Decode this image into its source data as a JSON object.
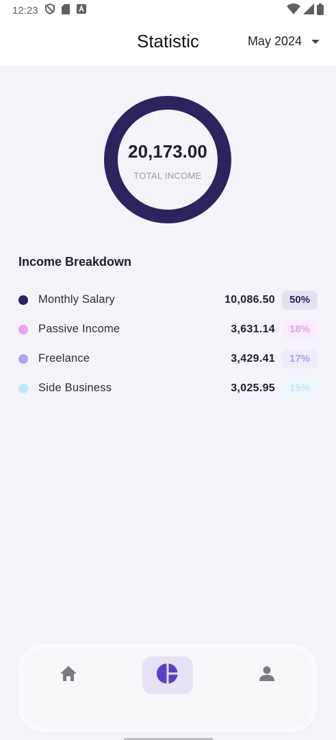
{
  "status_bar": {
    "time": "12:23"
  },
  "header": {
    "title": "Statistic",
    "month": "May 2024"
  },
  "summary": {
    "total_value": "20,173.00",
    "total_label": "TOTAL INCOME"
  },
  "breakdown": {
    "title": "Income Breakdown",
    "items": [
      {
        "label": "Monthly Salary",
        "amount": "10,086.50",
        "percent": "50%",
        "color": "#2b245f",
        "pct_bg": "#e4e1ee",
        "pct_color": "#2b245f"
      },
      {
        "label": "Passive Income",
        "amount": "3,631.14",
        "percent": "18%",
        "color": "#e9a3f0",
        "pct_bg": "#f8ecfa",
        "pct_color": "#e6a0ee"
      },
      {
        "label": "Freelance",
        "amount": "3,429.41",
        "percent": "17%",
        "color": "#b3a3ee",
        "pct_bg": "#efebfb",
        "pct_color": "#ad9ee9"
      },
      {
        "label": "Side Business",
        "amount": "3,025.95",
        "percent": "15%",
        "color": "#bfe6f5",
        "pct_bg": "#eef7fb",
        "pct_color": "#c4e8f5"
      }
    ]
  },
  "donut": {
    "ring_color": "#2b245f"
  },
  "nav": {
    "items": [
      {
        "icon": "home-icon",
        "active": false
      },
      {
        "icon": "pie-chart-icon",
        "active": true
      },
      {
        "icon": "profile-icon",
        "active": false
      }
    ],
    "active_color": "#5b3fc4",
    "inactive_color": "#7b7b80"
  }
}
